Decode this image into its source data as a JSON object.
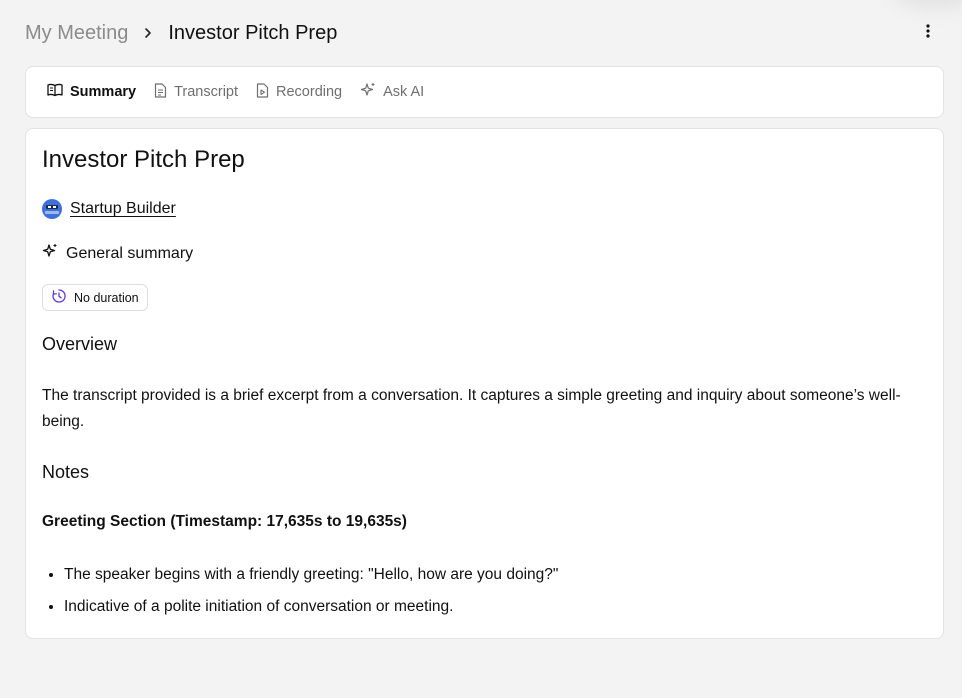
{
  "breadcrumb": {
    "parent": "My Meeting",
    "current": "Investor Pitch Prep"
  },
  "tabs": [
    {
      "label": "Summary",
      "icon": "book-open-icon",
      "active": true
    },
    {
      "label": "Transcript",
      "icon": "document-icon",
      "active": false
    },
    {
      "label": "Recording",
      "icon": "file-play-icon",
      "active": false
    },
    {
      "label": "Ask AI",
      "icon": "sparkles-icon",
      "active": false
    }
  ],
  "meeting": {
    "title": "Investor Pitch Prep",
    "owner": "Startup Builder",
    "summary_type": "General summary",
    "duration": "No duration"
  },
  "summary": {
    "overview_heading": "Overview",
    "overview_text": "The transcript provided is a brief excerpt from a conversation. It captures a simple greeting and inquiry about someone’s well-being.",
    "notes_heading": "Notes",
    "section_heading": "Greeting Section (Timestamp: 17,635s to 19,635s)",
    "bullets": [
      "The speaker begins with a friendly greeting: \"Hello, how are you doing?\"",
      "Indicative of a polite initiation of conversation or meeting."
    ]
  },
  "colors": {
    "background": "#f3f3f3",
    "card": "#ffffff",
    "border": "#e3e3e3",
    "avatar": "#3f6fd8",
    "duration_icon": "#5b35d6",
    "muted_text": "#8b8b8b"
  }
}
